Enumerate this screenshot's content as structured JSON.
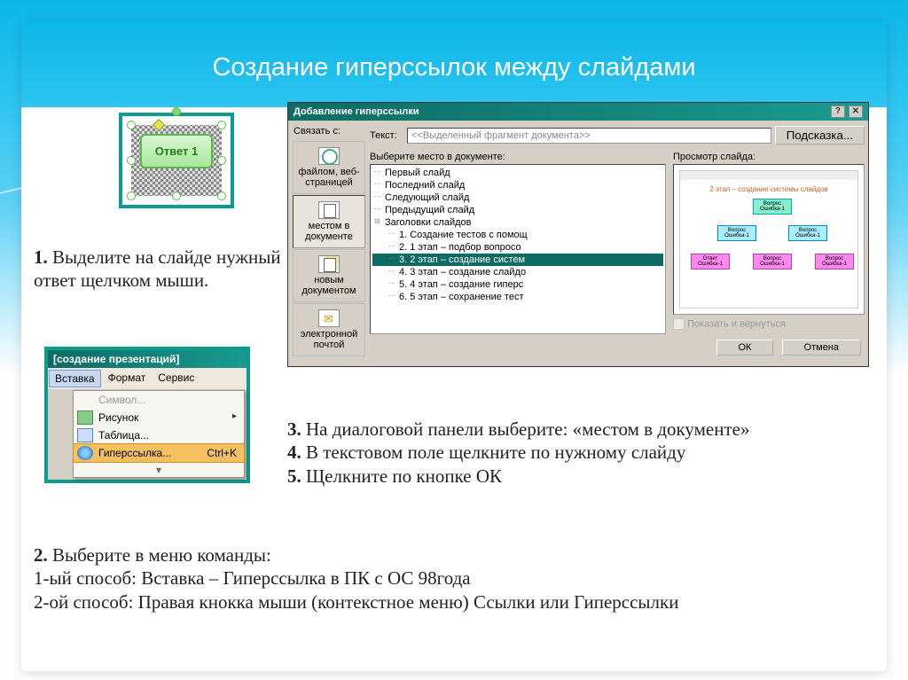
{
  "title": "Создание гиперссылок между слайдами",
  "answer_btn": "Ответ 1",
  "step1": {
    "n": "1.",
    "text": "Выделите на слайде нужный ответ щелчком мыши."
  },
  "step3": {
    "n": "3.",
    "text": "На диалоговой панели выберите: «местом в документе»"
  },
  "step4": {
    "n": "4.",
    "text": "В текстовом поле щелкните по нужному слайду"
  },
  "step5": {
    "n": "5.",
    "text": "Щелкните по кнопке ОК"
  },
  "step2": {
    "n": "2.",
    "text": "Выберите в меню команды:",
    "way1": "1-ый способ: Вставка – Гиперссылка в ПК с ОС 98года",
    "way2": "2-ой способ: Правая кнокка мыши (контекстное меню) Ссылки или Гиперссылки"
  },
  "dialog": {
    "title": "Добавление гиперссылки",
    "link_with": "Связать с:",
    "text_label": "Текст:",
    "text_value": "<<Выделенный фрагмент документа>>",
    "hint_btn": "Подсказка...",
    "opts": [
      "файлом, веб-страницей",
      "местом в документе",
      "новым документом",
      "электронной почтой"
    ],
    "choose_label": "Выберите место в документе:",
    "tree": [
      "Первый слайд",
      "Последний слайд",
      "Следующий слайд",
      "Предыдущий слайд",
      "Заголовки слайдов",
      "1. Создание тестов с помощ",
      "2. 1 этап – подбор вопросо",
      "3. 2 этап – создание систем",
      "4. 3 этап – создание слайдо",
      "5. 4 этап – создание гиперс",
      "6. 5 этап – сохранение тест"
    ],
    "preview_label": "Просмотр слайда:",
    "preview_title": "2 этап – создание системы слайдов",
    "show_return": "Показать и вернуться",
    "ok": "ОК",
    "cancel": "Отмена"
  },
  "menu": {
    "title": "[создание презентаций]",
    "bar": [
      "Вставка",
      "Формат",
      "Сервис"
    ],
    "items": {
      "symbol": "Символ...",
      "picture": "Рисунок",
      "table": "Таблица...",
      "hyperlink": "Гиперссылка...",
      "shortcut": "Ctrl+K"
    }
  }
}
